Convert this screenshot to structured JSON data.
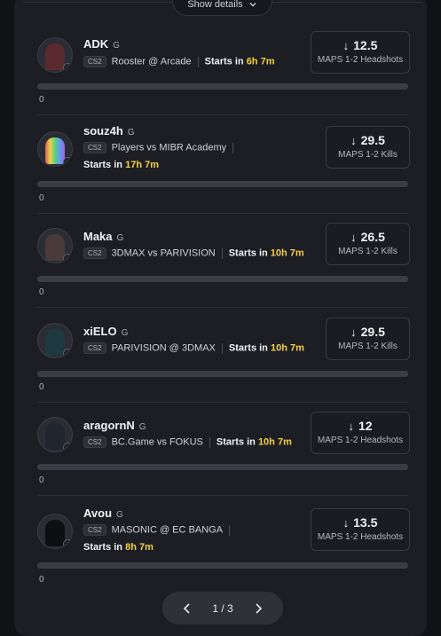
{
  "header": {
    "show_details_label": "Show details"
  },
  "cards": [
    {
      "player": "ADK",
      "role": "G",
      "game": "CS2",
      "match": "Rooster @ Arcade",
      "starts_prefix": "Starts in",
      "starts_time": "6h 7m",
      "line": "12.5",
      "stat": "MAPS 1-2 Headshots",
      "progress_label": "0",
      "progress": 0
    },
    {
      "player": "souz4h",
      "role": "G",
      "game": "CS2",
      "match": "Players vs MIBR Academy",
      "starts_prefix": "Starts in",
      "starts_time": "17h 7m",
      "line": "29.5",
      "stat": "MAPS 1-2 Kills",
      "progress_label": "0",
      "progress": 0
    },
    {
      "player": "Maka",
      "role": "G",
      "game": "CS2",
      "match": "3DMAX vs PARIVISION",
      "starts_prefix": "Starts in",
      "starts_time": "10h 7m",
      "line": "26.5",
      "stat": "MAPS 1-2 Kills",
      "progress_label": "0",
      "progress": 0
    },
    {
      "player": "xiELO",
      "role": "G",
      "game": "CS2",
      "match": "PARIVISION @ 3DMAX",
      "starts_prefix": "Starts in",
      "starts_time": "10h 7m",
      "line": "29.5",
      "stat": "MAPS 1-2 Kills",
      "progress_label": "0",
      "progress": 0
    },
    {
      "player": "aragornN",
      "role": "G",
      "game": "CS2",
      "match": "BC.Game vs FOKUS",
      "starts_prefix": "Starts in",
      "starts_time": "10h 7m",
      "line": "12",
      "stat": "MAPS 1-2 Headshots",
      "progress_label": "0",
      "progress": 0
    },
    {
      "player": "Avou",
      "role": "G",
      "game": "CS2",
      "match": "MASONIC @ EC BANGA",
      "starts_prefix": "Starts in",
      "starts_time": "8h 7m",
      "line": "13.5",
      "stat": "MAPS 1-2 Headshots",
      "progress_label": "0",
      "progress": 0
    }
  ],
  "pagination": {
    "label": "1 / 3"
  },
  "colors": {
    "accent_time": "#f5d142",
    "panel": "#1c1e24",
    "background": "#101216"
  },
  "icons": {
    "direction": "arrow-down-icon",
    "prev": "chevron-left-icon",
    "next": "chevron-right-icon",
    "expand": "chevron-down-icon"
  }
}
